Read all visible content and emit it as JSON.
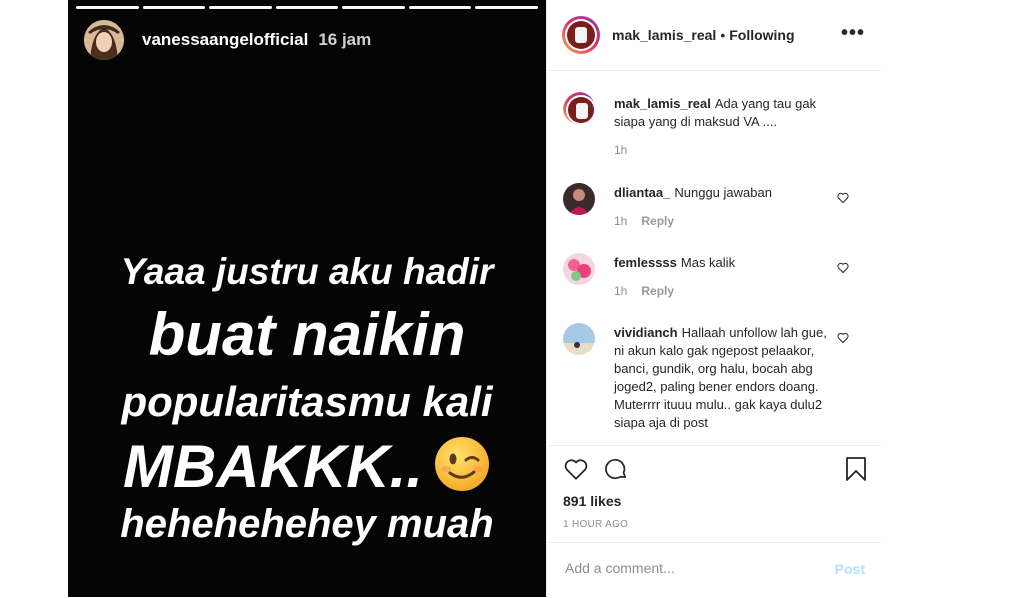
{
  "story": {
    "username": "vanessaangelofficial",
    "time": "16 jam",
    "lines": [
      "Yaaa justru aku hadir",
      "buat naikin",
      "popularitasmu kali",
      "MBAKKK..",
      "hehehehehey muah"
    ],
    "emoji_icon": "winking-face-emoji",
    "progress_segments_total": 7,
    "progress_segments_viewed": 7
  },
  "post_header": {
    "username": "mak_lamis_real",
    "separator": "•",
    "follow_status": "Following",
    "more_icon": "ellipsis-icon"
  },
  "caption": {
    "username": "mak_lamis_real",
    "text": "Ada yang tau gak siapa yang di maksud VA ....",
    "time": "1h"
  },
  "comments": [
    {
      "username": "dliantaa_",
      "text": "Nunggu jawaban",
      "time": "1h",
      "reply": "Reply"
    },
    {
      "username": "femlessss",
      "text": "Mas kalik",
      "time": "1h",
      "reply": "Reply"
    },
    {
      "username": "vividianch",
      "text": "Hallaah unfollow lah gue, ni akun kalo gak ngepost pelaakor, banci, gundik, org halu, bocah abg joged2, paling bener endors doang. Muterrrr ituuu mulu.. gak kaya dulu2 siapa aja di post"
    }
  ],
  "actions": {
    "likes": "891 likes",
    "time_ago": "1 HOUR AGO",
    "icons": [
      "heart-icon",
      "comment-icon",
      "bookmark-icon"
    ]
  },
  "add_comment": {
    "placeholder": "Add a comment...",
    "post_label": "Post"
  },
  "colors": {
    "story_bg": "#050505",
    "post_button": "#b2dffc",
    "muted_text": "#8e8e8e"
  }
}
